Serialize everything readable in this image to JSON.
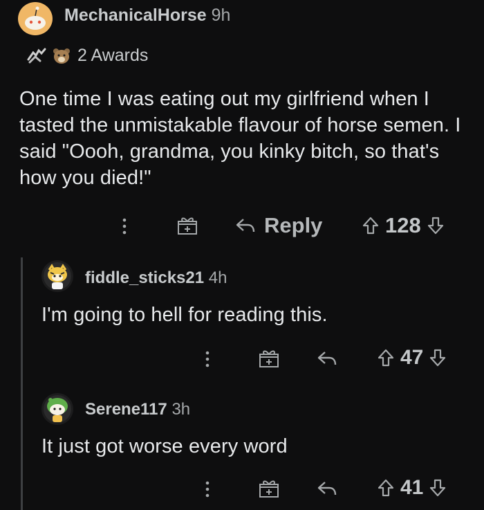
{
  "top_comment": {
    "username": "MechanicalHorse",
    "age": "9h",
    "awards_label": "2 Awards",
    "body": "One time I was eating out my girlfriend when I tasted the unmistakable flavour of horse semen. I said \"Oooh, grandma, you kinky bitch, so that's how you died!\"",
    "reply_label": "Reply",
    "score": "128"
  },
  "replies": [
    {
      "username": "fiddle_sticks21",
      "age": "4h",
      "body": "I'm going to hell for reading this.",
      "score": "47"
    },
    {
      "username": "Serene117",
      "age": "3h",
      "body": "It just got worse every word",
      "score": "41"
    }
  ],
  "colors": {
    "background": "#0e0e0f",
    "text": "#e8eaec",
    "muted": "#a6a9ab",
    "avatar_orange": "#f0b766",
    "thread_line": "#3d3f42"
  }
}
